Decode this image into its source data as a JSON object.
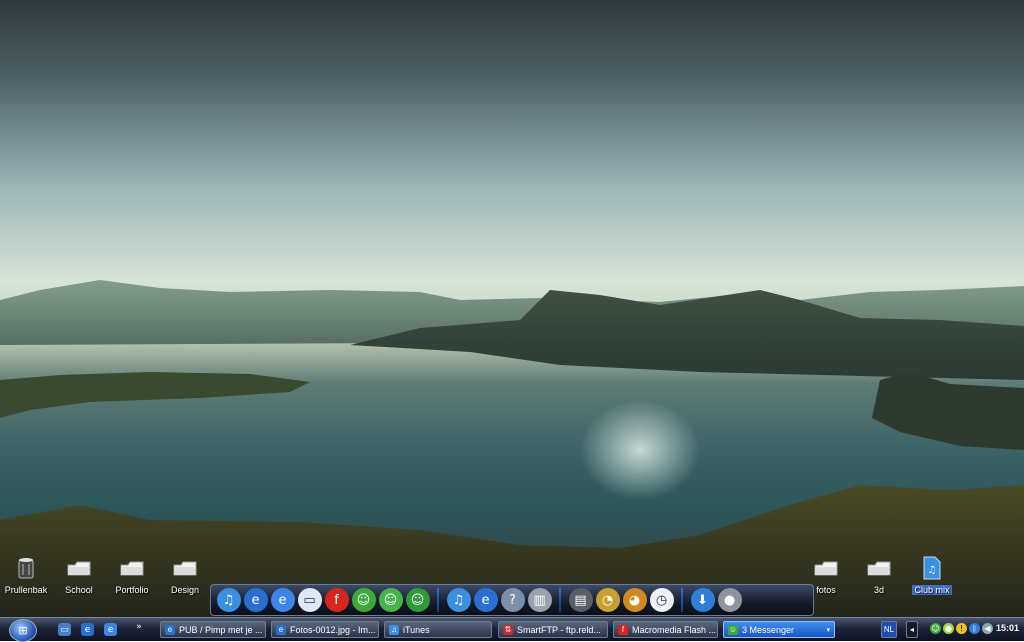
{
  "desktop_left": [
    {
      "label": "Prullenbak",
      "icon": "recycle-bin-icon"
    },
    {
      "label": "School",
      "icon": "folder-icon"
    },
    {
      "label": "Portfolio",
      "icon": "folder-icon"
    },
    {
      "label": "Design",
      "icon": "folder-icon"
    }
  ],
  "desktop_right": [
    {
      "label": "fotos",
      "icon": "folder-icon"
    },
    {
      "label": "3d",
      "icon": "folder-icon"
    },
    {
      "label": "Club mix",
      "icon": "music-file-icon",
      "selected": true
    }
  ],
  "dock": {
    "group1": [
      {
        "name": "itunes-icon",
        "glyph": "♫",
        "bg": "#3a8fe0"
      },
      {
        "name": "internet-explorer-icon",
        "glyph": "e",
        "bg": "#2a6fd0"
      },
      {
        "name": "internet-explorer-icon-2",
        "glyph": "e",
        "bg": "#3b86e8"
      },
      {
        "name": "window-icon",
        "glyph": "▭",
        "bg": "#dfe8f5"
      },
      {
        "name": "flash-icon",
        "glyph": "f",
        "bg": "#d7261e"
      },
      {
        "name": "messenger-icon",
        "glyph": "☺",
        "bg": "#3fa83a"
      },
      {
        "name": "messenger-chat-icon",
        "glyph": "☺",
        "bg": "#48b34a"
      },
      {
        "name": "messenger-contacts-icon",
        "glyph": "☺",
        "bg": "#2f9a3a"
      }
    ],
    "group2": [
      {
        "name": "itunes-icon-2",
        "glyph": "♫",
        "bg": "#3a8fe0"
      },
      {
        "name": "internet-explorer-icon-3",
        "glyph": "e",
        "bg": "#2a6fd0"
      },
      {
        "name": "help-icon",
        "glyph": "?",
        "bg": "#7d8fa8"
      },
      {
        "name": "recycle-bin-icon",
        "glyph": "▥",
        "bg": "#9aa3ad"
      }
    ],
    "group3": [
      {
        "name": "drive-icon",
        "glyph": "▤",
        "bg": "#5a5f66"
      },
      {
        "name": "cpu-gauge-icon",
        "glyph": "◔",
        "bg": "#c8a030"
      },
      {
        "name": "ram-gauge-icon",
        "glyph": "◕",
        "bg": "#d08a20"
      },
      {
        "name": "clock-icon",
        "glyph": "◷",
        "bg": "#eef2f6"
      }
    ],
    "group4": [
      {
        "name": "download-icon",
        "glyph": "⬇",
        "bg": "#2f7fd8"
      },
      {
        "name": "alien-icon",
        "glyph": "●",
        "bg": "#8e949c"
      }
    ]
  },
  "taskbar": {
    "quicklaunch_more": "»",
    "buttons": [
      {
        "label": "PUB / Pimp met je ...",
        "icon": "internet-explorer-icon",
        "color": "#2a6fd0",
        "glyph": "e",
        "active": false
      },
      {
        "label": "Fotos-0012.jpg - Im...",
        "icon": "image-viewer-icon",
        "color": "#2a6fd0",
        "glyph": "e",
        "active": false
      },
      {
        "label": "iTunes",
        "icon": "itunes-icon",
        "color": "#3a8fe0",
        "glyph": "♫",
        "active": false
      },
      {
        "label": "SmartFTP - ftp.reld...",
        "icon": "ftp-icon",
        "color": "#c03030",
        "glyph": "⇅",
        "active": false
      },
      {
        "label": "Macromedia Flash ...",
        "icon": "flash-icon",
        "color": "#d7261e",
        "glyph": "f",
        "active": false
      },
      {
        "label": "3 Messenger",
        "icon": "messenger-icon",
        "color": "#3fa83a",
        "glyph": "☺",
        "active": true
      }
    ],
    "language": "NL",
    "clock": "15:01"
  }
}
